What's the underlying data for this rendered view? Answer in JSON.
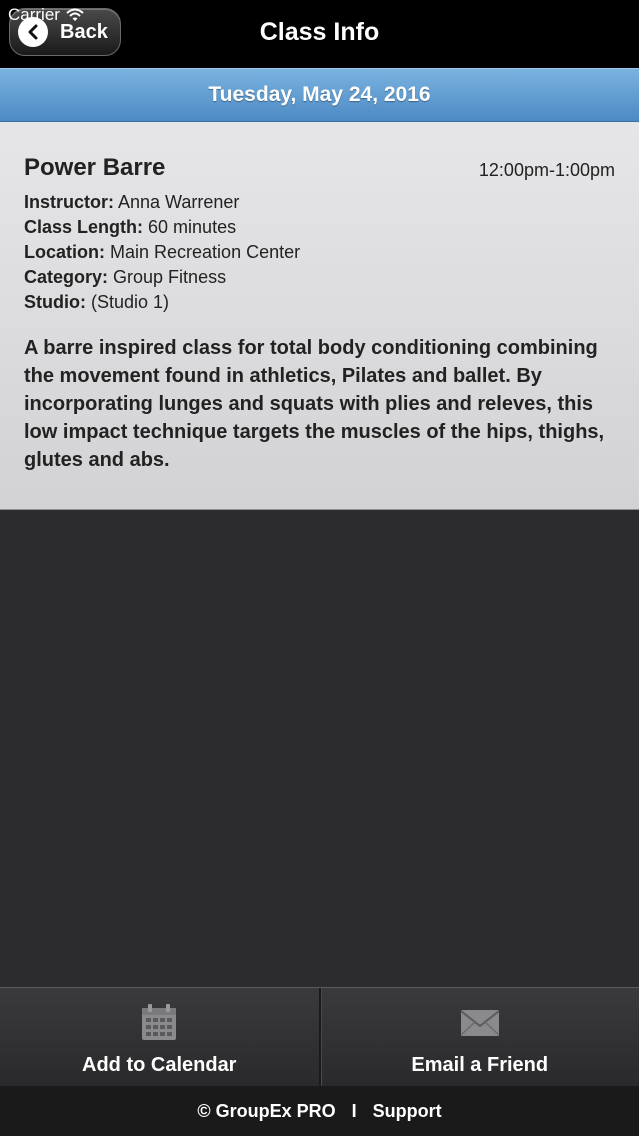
{
  "status_bar": {
    "carrier": "Carrier",
    "icons": [
      "wifi-icon"
    ]
  },
  "nav": {
    "back_label": "Back",
    "title": "Class Info"
  },
  "date": "Tuesday, May 24, 2016",
  "class_info": {
    "name": "Power Barre",
    "time": "12:00pm-1:00pm",
    "details": [
      {
        "label": "Instructor:",
        "value": "Anna Warrener"
      },
      {
        "label": "Class Length:",
        "value": "60 minutes"
      },
      {
        "label": "Location:",
        "value": "Main Recreation Center"
      },
      {
        "label": "Category:",
        "value": "Group Fitness"
      },
      {
        "label": "Studio:",
        "value": "(Studio 1)"
      }
    ],
    "description": "A barre inspired class for total body conditioning combining the movement found in athletics, Pilates and ballet. By incorporating lunges and squats with plies and releves, this low impact technique targets the muscles of the hips, thighs, glutes and abs."
  },
  "actions": [
    {
      "label": "Add to Calendar",
      "icon": "calendar-icon"
    },
    {
      "label": "Email a Friend",
      "icon": "envelope-icon"
    }
  ],
  "footer": {
    "copyright": "© GroupEx PRO",
    "separator": "I",
    "support": "Support"
  },
  "colors": {
    "nav_bg": "#000000",
    "date_bar": "#5f9dd2",
    "panel_bg": "#dcdcde",
    "body_bg": "#2c2c2e",
    "footer_bg": "#1a1a1a"
  }
}
